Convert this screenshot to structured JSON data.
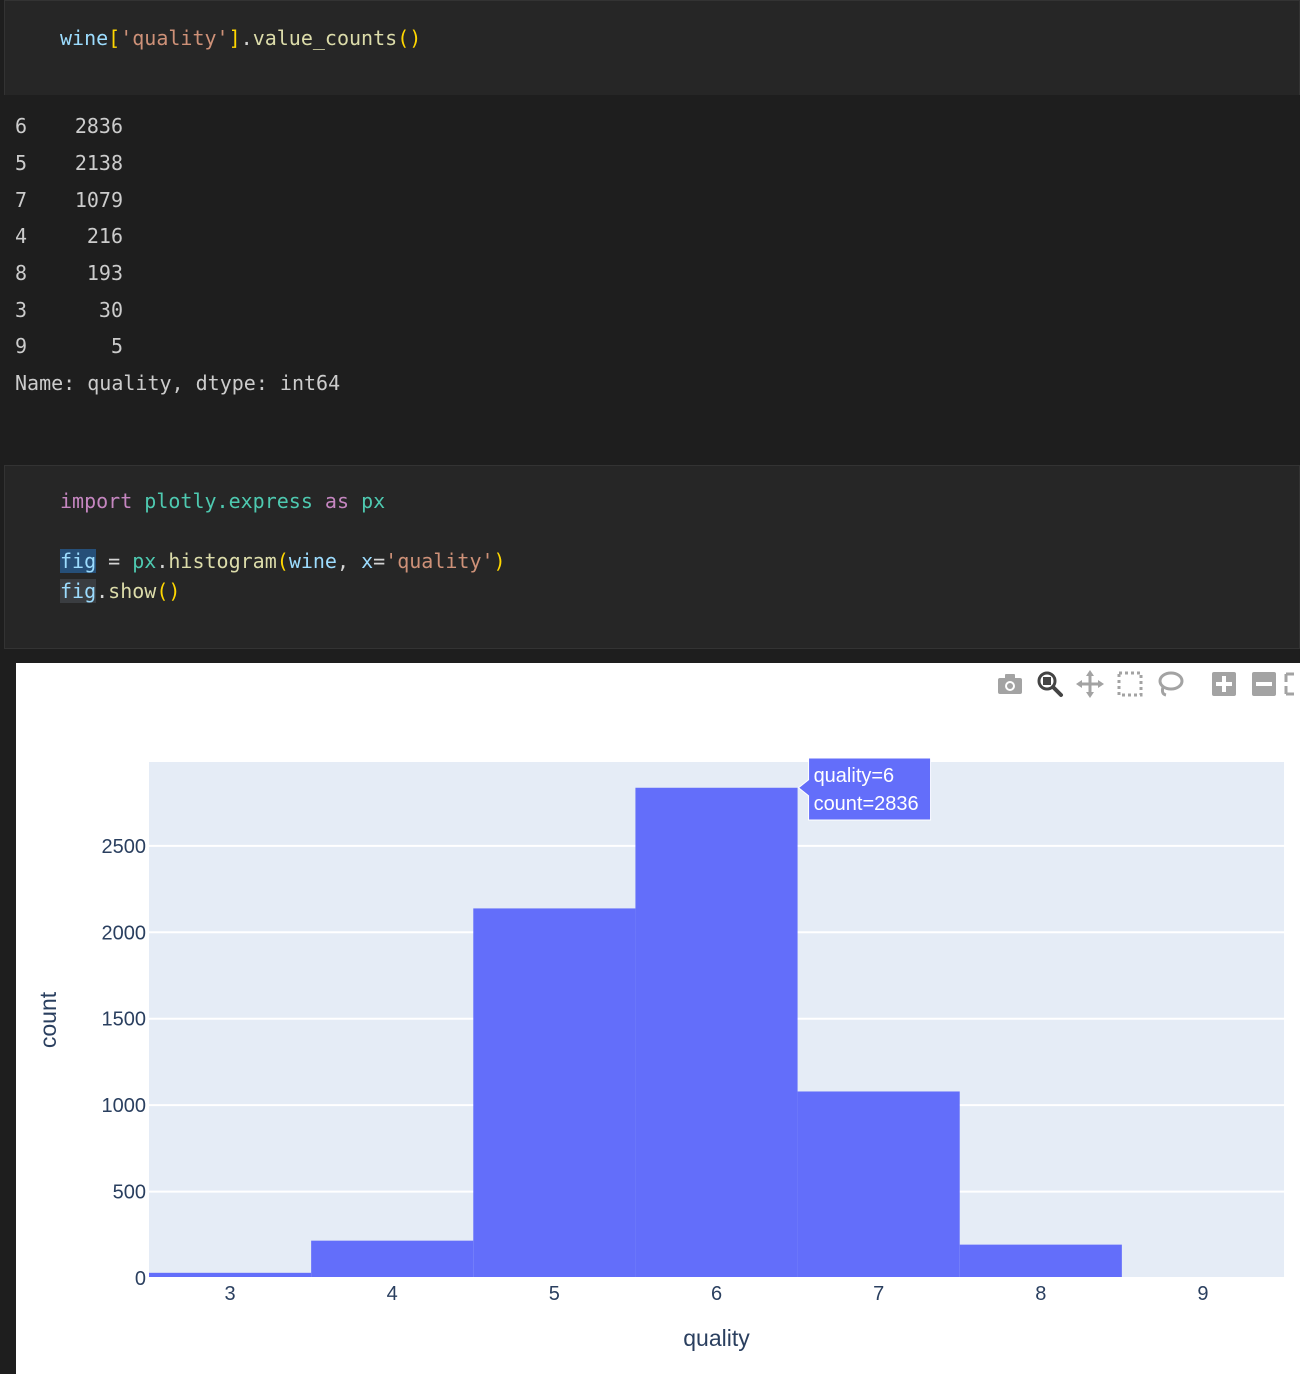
{
  "cell1": {
    "code": {
      "var": "wine",
      "open_bracket": "[",
      "key": "'quality'",
      "close_bracket": "]",
      "dot": ".",
      "method": "value_counts",
      "parens": "()"
    }
  },
  "output1": {
    "rows": [
      {
        "index": "6",
        "value": "2836"
      },
      {
        "index": "5",
        "value": "2138"
      },
      {
        "index": "7",
        "value": "1079"
      },
      {
        "index": "4",
        "value": "216"
      },
      {
        "index": "8",
        "value": "193"
      },
      {
        "index": "3",
        "value": "30"
      },
      {
        "index": "9",
        "value": "5"
      }
    ],
    "footer": "Name: quality, dtype: int64"
  },
  "cell2": {
    "line1": {
      "kw": "import",
      "module": "plotly.express",
      "as": "as",
      "alias": "px"
    },
    "line2": {
      "var": "fig",
      "eq": " = ",
      "mod": "px",
      "dot": ".",
      "fn": "histogram",
      "open": "(",
      "arg1": "wine",
      "comma": ", ",
      "kwarg": "x",
      "eqs": "=",
      "str": "'quality'",
      "close": ")"
    },
    "line3": {
      "var": "fig",
      "dot": ".",
      "fn": "show",
      "parens": "()"
    }
  },
  "modebar": {
    "icons": [
      "camera-icon",
      "zoom-icon",
      "pan-icon",
      "box-select-icon",
      "lasso-select-icon",
      "zoom-in-icon",
      "zoom-out-icon",
      "autoscale-icon"
    ]
  },
  "tooltip": {
    "line1": "quality=6",
    "line2": "count=2836"
  },
  "colors": {
    "bar": "#636efa",
    "plot_bg": "#e5ecf6",
    "axis_text": "#2a3f5f"
  },
  "chart_data": {
    "type": "bar",
    "categories": [
      "3",
      "4",
      "5",
      "6",
      "7",
      "8",
      "9"
    ],
    "values": [
      30,
      216,
      2138,
      2836,
      1079,
      193,
      5
    ],
    "xlabel": "quality",
    "ylabel": "count",
    "yticks": [
      0,
      500,
      1000,
      1500,
      2000,
      2500
    ],
    "ylim": [
      0,
      2985
    ],
    "grid": true,
    "bar_gap": 0
  }
}
